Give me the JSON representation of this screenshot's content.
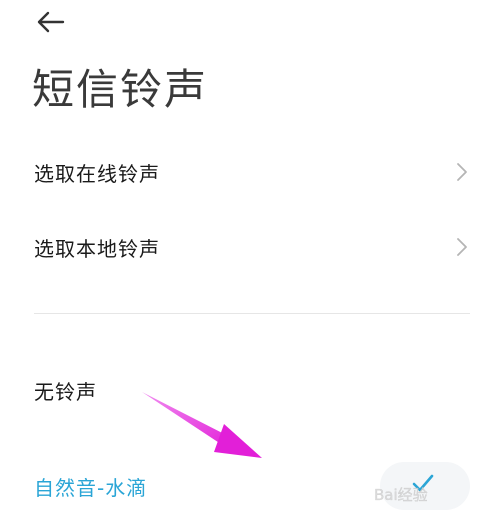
{
  "header": {
    "back_icon": "arrow-left-icon",
    "title": "短信铃声"
  },
  "menu": {
    "online_label": "选取在线铃声",
    "local_label": "选取本地铃声"
  },
  "ringtones": {
    "items": [
      {
        "label": "无铃声",
        "selected": false
      },
      {
        "label": "自然音-水滴",
        "selected": true
      }
    ]
  },
  "colors": {
    "accent": "#2aa5d6",
    "annotation_arrow": "#e83fe0",
    "text_primary": "#1a1a1a",
    "divider": "#e6e6e6"
  },
  "icons": {
    "chevron": "chevron-right-icon",
    "check": "check-icon"
  },
  "watermark": {
    "text": "Bai经验"
  }
}
